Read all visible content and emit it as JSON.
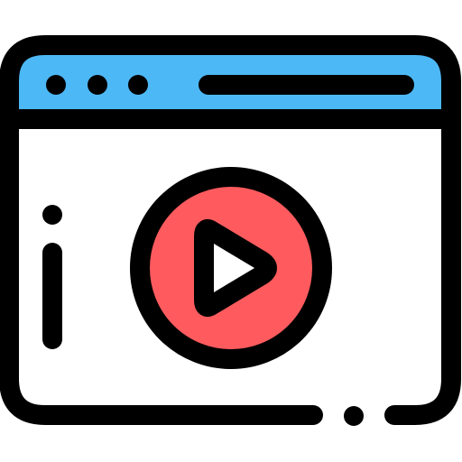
{
  "icon": {
    "name": "video-player-window",
    "colors": {
      "outline": "#000000",
      "titlebar": "#4DB8F6",
      "body": "#FFFFFF",
      "play_circle": "#FF5B5E",
      "play_triangle": "#FFFFFF"
    },
    "window_dots": 3
  }
}
